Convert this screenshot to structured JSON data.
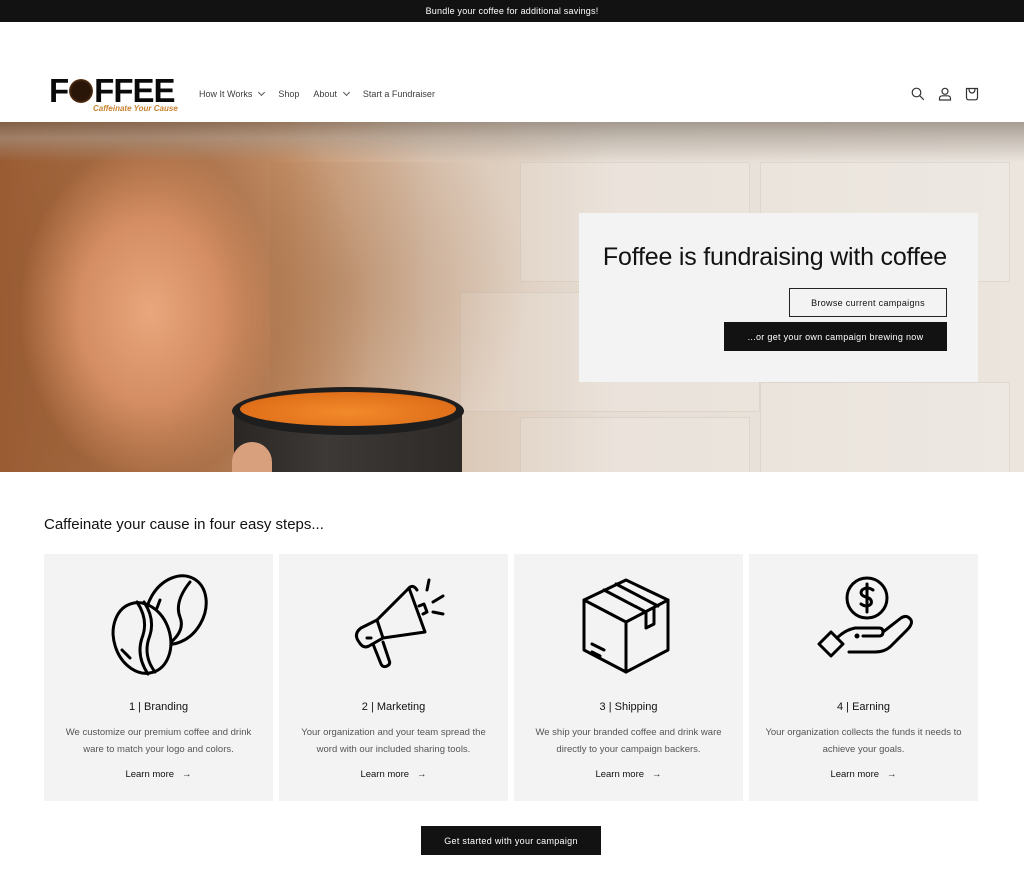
{
  "announcement": "Bundle your coffee for additional savings!",
  "header": {
    "logo_text_before": "F",
    "logo_text_after": "FFEE",
    "logo_tagline": "Caffeinate Your Cause",
    "nav": [
      {
        "label": "How It Works",
        "has_dropdown": true
      },
      {
        "label": "Shop",
        "has_dropdown": false
      },
      {
        "label": "About",
        "has_dropdown": true
      },
      {
        "label": "Start a Fundraiser",
        "has_dropdown": false
      }
    ],
    "icons": [
      "search-icon",
      "account-icon",
      "cart-icon"
    ]
  },
  "hero": {
    "title": "Foffee is fundraising with coffee",
    "browse_button": "Browse current campaigns",
    "brew_button": "...or get your own campaign brewing now"
  },
  "steps_section": {
    "heading": "Caffeinate your cause in four easy steps...",
    "steps": [
      {
        "icon": "coffee-beans-icon",
        "title": "1 | Branding",
        "description": "We customize our premium coffee and drink ware to match your logo and colors.",
        "link": "Learn more"
      },
      {
        "icon": "megaphone-icon",
        "title": "2 | Marketing",
        "description": "Your organization and your team spread the word with our included sharing tools.",
        "link": "Learn more"
      },
      {
        "icon": "box-icon",
        "title": "3 | Shipping",
        "description": "We ship your branded coffee and drink ware directly to your campaign backers.",
        "link": "Learn more"
      },
      {
        "icon": "hand-coin-icon",
        "title": "4 | Earning",
        "description": "Your organization collects the funds it needs to achieve your goals.",
        "link": "Learn more"
      }
    ]
  },
  "cta_button": "Get started with your campaign",
  "colors": {
    "announcement_bg": "#121212",
    "button_dark": "#121212",
    "card_bg": "#f3f3f3",
    "logo_tagline": "#c9822f"
  }
}
